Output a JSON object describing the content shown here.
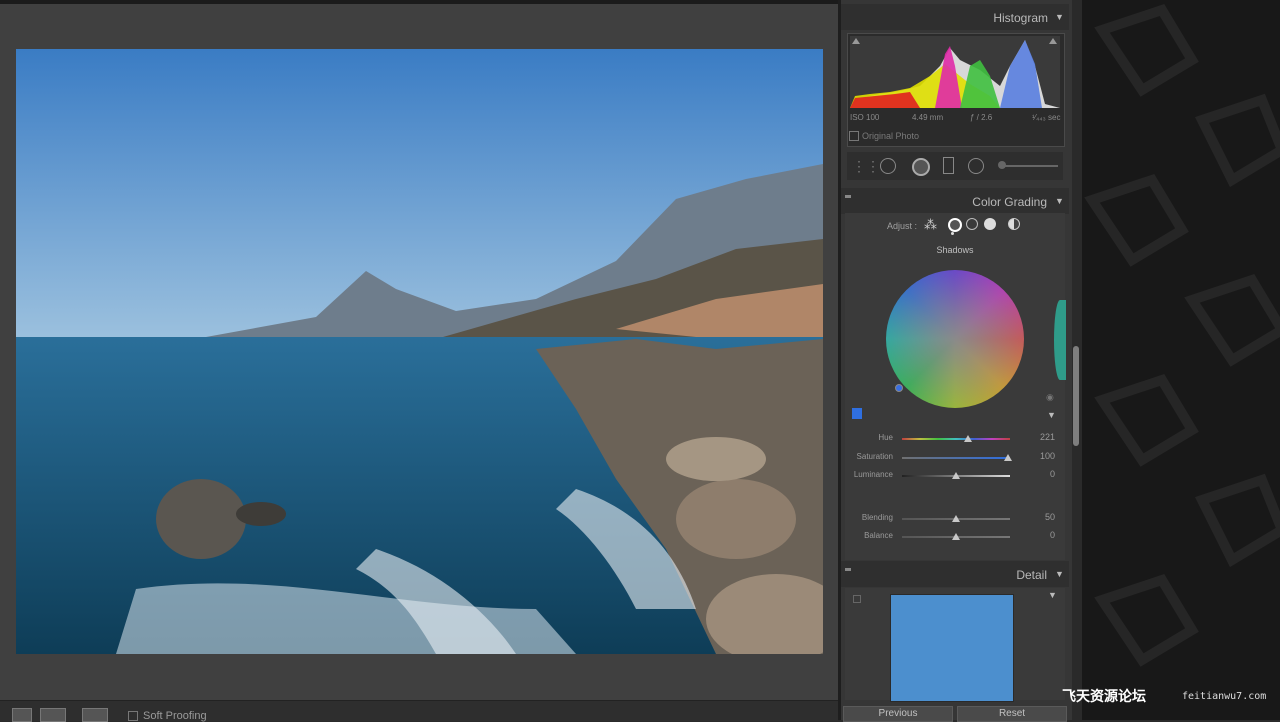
{
  "histogram": {
    "title": "Histogram",
    "iso": "ISO 100",
    "focal": "4.49 mm",
    "aperture": "ƒ / 2.6",
    "shutter": "¹⁄₄₄₃ sec",
    "original_photo_label": "Original Photo"
  },
  "color_grading": {
    "title": "Color Grading",
    "adjust_label": "Adjust :",
    "mode_label": "Shadows",
    "sliders": [
      {
        "label": "Hue",
        "value": "221",
        "level": 0.61
      },
      {
        "label": "Saturation",
        "value": "100",
        "level": 0.98
      },
      {
        "label": "Luminance",
        "value": "0",
        "level": 0.5
      },
      {
        "label": "Blending",
        "value": "50",
        "level": 0.5
      },
      {
        "label": "Balance",
        "value": "0",
        "level": 0.5
      }
    ],
    "swatch_color": "#2f6fe0"
  },
  "detail": {
    "title": "Detail",
    "preview_color": "#4c8fce"
  },
  "footer": {
    "previous": "Previous",
    "reset": "Reset"
  },
  "toolbar": {
    "soft_proofing": "Soft Proofing"
  },
  "watermark": {
    "text": "飞天资源论坛",
    "url": "feitianwu7.com"
  }
}
